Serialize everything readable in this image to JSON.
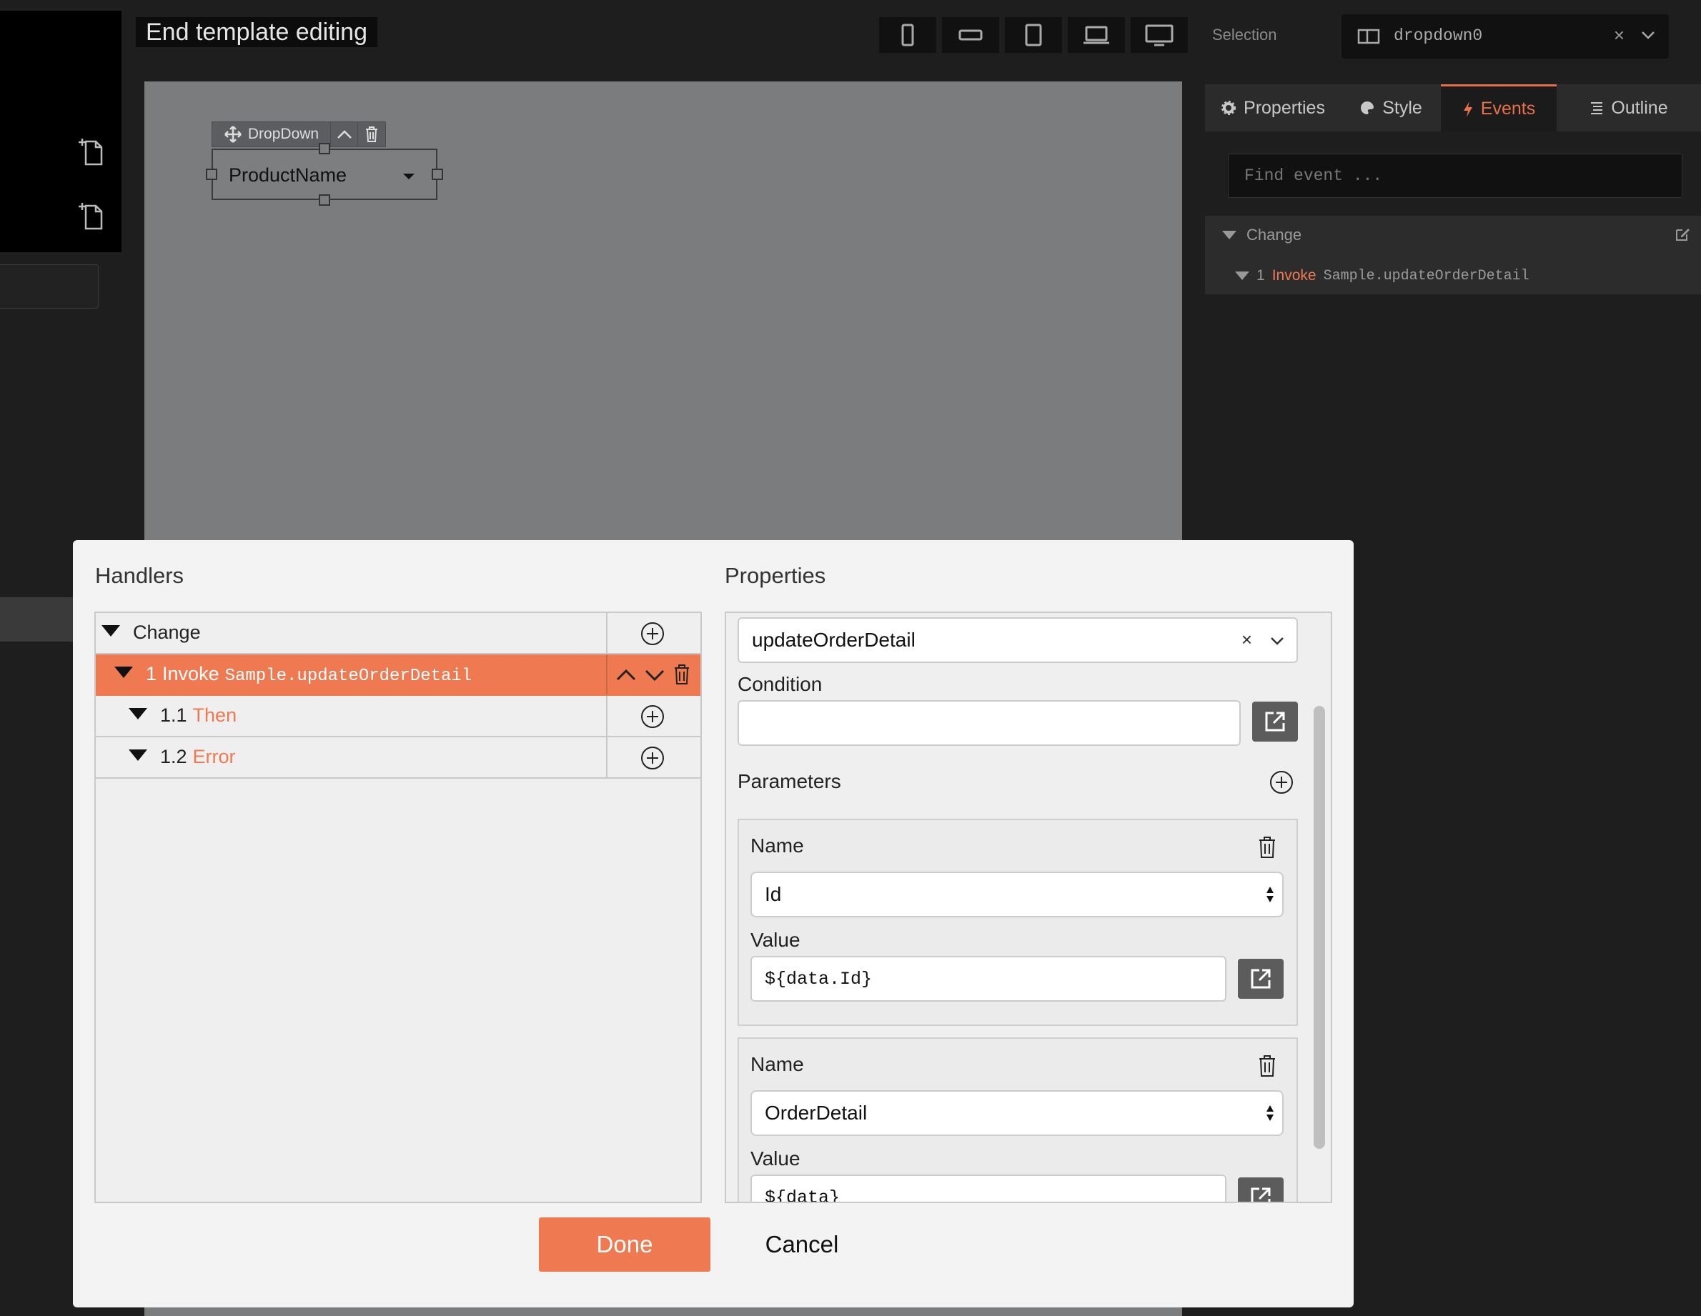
{
  "toolbar": {
    "end_template_label": "End template editing",
    "device_icons": [
      "phone-portrait-icon",
      "phone-landscape-icon",
      "tablet-portrait-icon",
      "laptop-icon",
      "desktop-icon"
    ]
  },
  "canvas": {
    "dropdown_toolbar_label": "DropDown",
    "dropdown_value": "ProductName"
  },
  "right_panel": {
    "selection_label": "Selection",
    "selection_value": "dropdown0",
    "clear_symbol": "×",
    "tabs": [
      {
        "label": "Properties",
        "icon": "gear-icon"
      },
      {
        "label": "Style",
        "icon": "palette-icon"
      },
      {
        "label": "Events",
        "icon": "bolt-icon",
        "active": true
      },
      {
        "label": "Outline",
        "icon": "outline-icon"
      }
    ],
    "find_event_placeholder": "Find event ...",
    "event_name": "Change",
    "event_action_number": "1",
    "event_action_type": "Invoke",
    "event_action_target": "Sample.updateOrderDetail"
  },
  "dialog": {
    "handlers_title": "Handlers",
    "properties_title": "Properties",
    "tree": {
      "root_label": "Change",
      "invoke_number": "1",
      "invoke_type": "Invoke",
      "invoke_target": "Sample.updateOrderDetail",
      "then_number": "1.1",
      "then_label": "Then",
      "error_number": "1.2",
      "error_label": "Error"
    },
    "props": {
      "method_value": "updateOrderDetail",
      "clear_symbol": "×",
      "condition_label": "Condition",
      "condition_value": "",
      "parameters_label": "Parameters",
      "params": [
        {
          "name_label": "Name",
          "name_value": "Id",
          "value_label": "Value",
          "value": "${data.Id}"
        },
        {
          "name_label": "Name",
          "name_value": "OrderDetail",
          "value_label": "Value",
          "value": "${data}"
        }
      ]
    },
    "done_label": "Done",
    "cancel_label": "Cancel"
  },
  "colors": {
    "accent": "#ef7a52",
    "canvas_bg": "#7b7c7e",
    "panel_bg": "#1e1e1e",
    "dialog_bg": "#f3f3f3"
  }
}
